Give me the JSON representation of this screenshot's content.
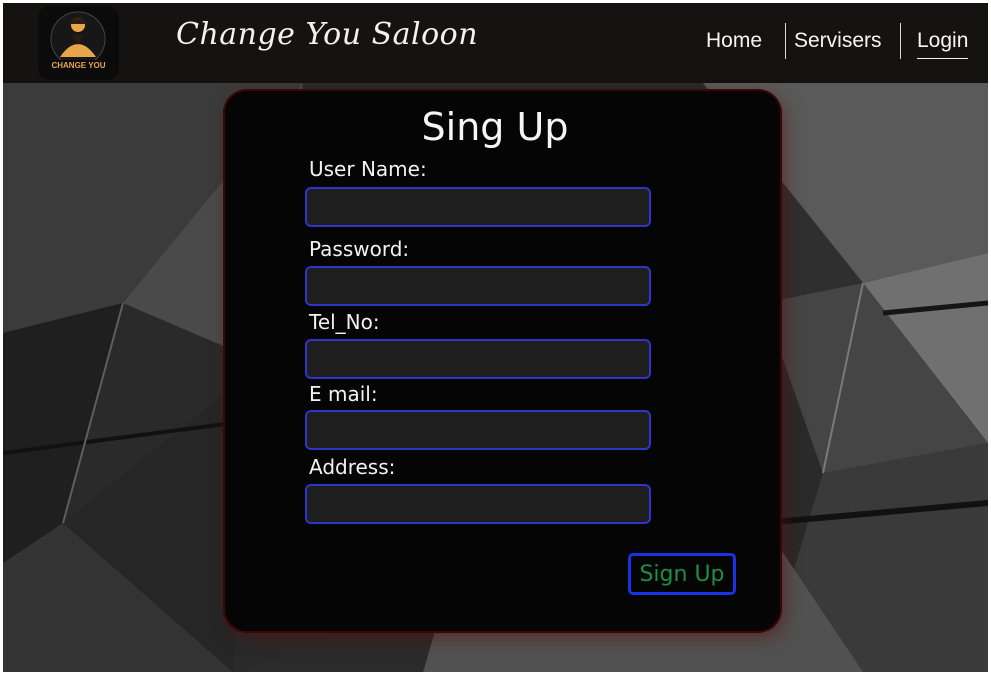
{
  "navbar": {
    "logo_text": "CHANGE YOU",
    "brand": "Change You Saloon",
    "links": [
      {
        "label": "Home"
      },
      {
        "label": "Servisers"
      },
      {
        "label": "Login"
      }
    ]
  },
  "form": {
    "title": "Sing Up",
    "fields": [
      {
        "label": "User Name:",
        "value": "",
        "placeholder": ""
      },
      {
        "label": "Password:",
        "value": "",
        "placeholder": ""
      },
      {
        "label": "Tel_No:",
        "value": "",
        "placeholder": ""
      },
      {
        "label": "E mail:",
        "value": "",
        "placeholder": ""
      },
      {
        "label": "Address:",
        "value": "",
        "placeholder": ""
      }
    ],
    "submit_label": "Sign Up"
  },
  "colors": {
    "navbar_bg": "#151212",
    "input_border": "#2d36c9",
    "submit_border": "#1833e6",
    "submit_text": "#1d8f43",
    "panel_glow": "#3a0606",
    "logo_gold": "#e8a64a"
  }
}
